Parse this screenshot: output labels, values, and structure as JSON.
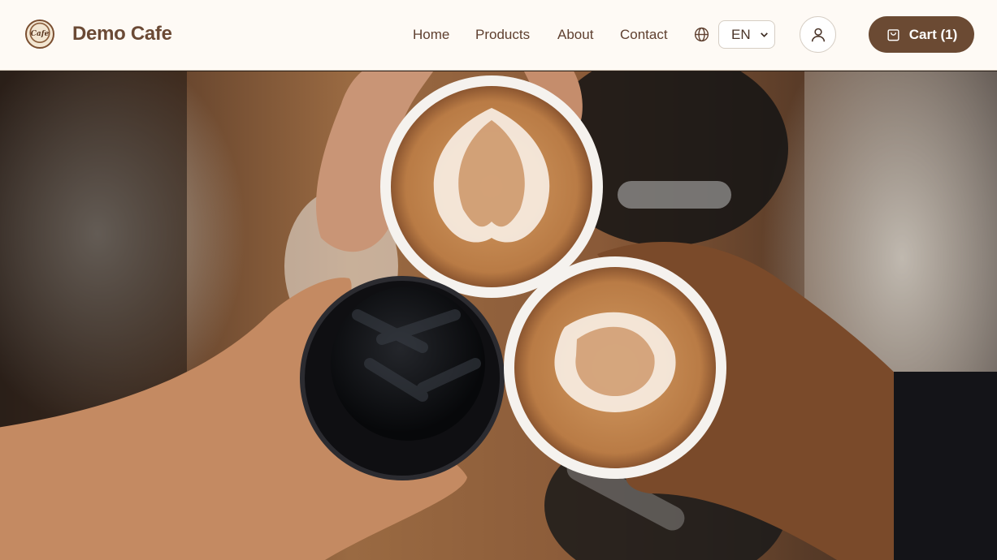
{
  "header": {
    "logo_text": "Cafe",
    "brand": "Demo Cafe",
    "nav": [
      {
        "label": "Home"
      },
      {
        "label": "Products"
      },
      {
        "label": "About"
      },
      {
        "label": "Contact"
      }
    ],
    "language": {
      "selected": "EN"
    },
    "cart_label": "Cart (1)"
  },
  "hero": {
    "image_alt": "Three hands toasting two latte art coffees and an iced coffee over a wooden table"
  },
  "icons": {
    "globe": "globe-icon",
    "chevron": "chevron-down-icon",
    "user": "user-icon",
    "cart": "shopping-bag-icon"
  },
  "colors": {
    "nav_bg": "#fefaf5",
    "brand": "#6b4a35",
    "cart_button": "#6b4a33"
  }
}
